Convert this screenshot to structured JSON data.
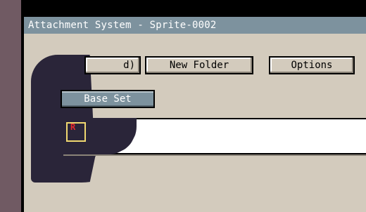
{
  "window": {
    "title": "Attachment System - Sprite-0002"
  },
  "toolbar": {
    "partial_button_label": "d)",
    "new_folder_label": "New Folder",
    "options_label": "Options"
  },
  "sets": {
    "base_set_label": "Base Set"
  },
  "attachments": {
    "slot_letter": "R"
  },
  "colors": {
    "titlebar": "#7d929e",
    "window_bg": "#d3cbbd",
    "overlay": "#2a2539",
    "slot_border": "#f0d870",
    "slot_letter": "#e8282d"
  }
}
